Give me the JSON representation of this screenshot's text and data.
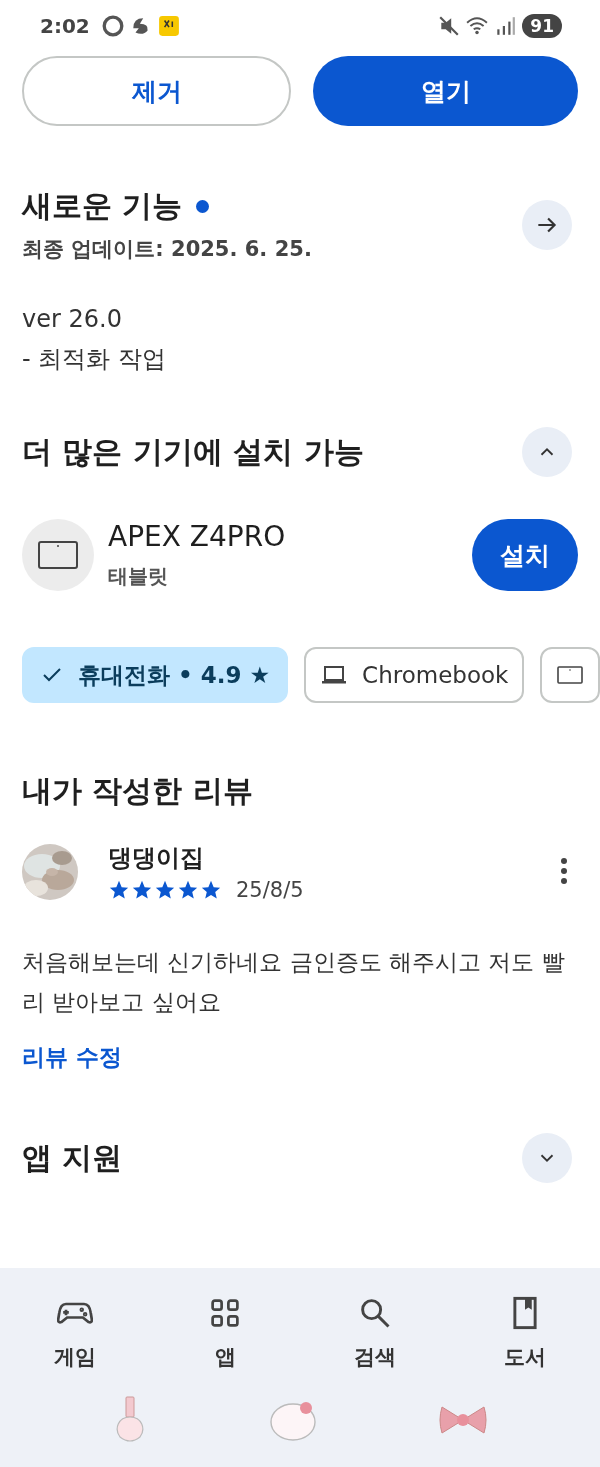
{
  "status_bar": {
    "time": "2:02",
    "battery": "91"
  },
  "actions": [
    {
      "label": "제거",
      "kind": "outline"
    },
    {
      "label": "열기",
      "kind": "filled"
    }
  ],
  "whats_new": {
    "title": "새로운 기능",
    "new_dot": true,
    "updated": "최종 업데이트: 2025. 6. 25.",
    "notes": [
      "ver 26.0",
      "- 최적화 작업"
    ]
  },
  "devices_section": {
    "title": "더 많은 기기에 설치 가능",
    "expanded": true,
    "device": {
      "name": "APEX Z4PRO",
      "type": "태블릿",
      "button": "설치"
    },
    "chips": [
      {
        "label": "휴대전화 • 4.9 ★",
        "selected": true
      },
      {
        "label": "Chromebook",
        "kind": "laptop",
        "selected": false
      },
      {
        "kind": "tablet",
        "selected": false
      }
    ]
  },
  "my_review": {
    "title": "내가 작성한 리뷰",
    "author": "댕댕이집",
    "stars": 5,
    "date": "25/8/5",
    "text": "처음해보는데 신기하네요 금인증도 해주시고 저도 빨리 받아보고 싶어요",
    "edit_link": "리뷰 수정"
  },
  "app_support": {
    "title": "앱 지원",
    "expanded": false
  },
  "bottom_nav": [
    {
      "label": "게임"
    },
    {
      "label": "앱"
    },
    {
      "label": "검색"
    },
    {
      "label": "도서"
    }
  ]
}
